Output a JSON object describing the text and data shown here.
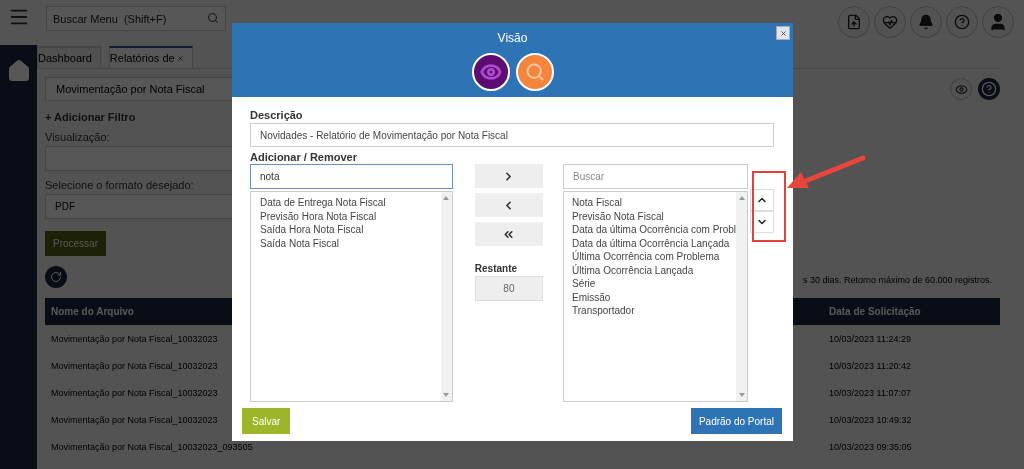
{
  "topbar": {
    "search": {
      "placeholder": "Buscar Menu  (Shift+F)"
    }
  },
  "tabs": [
    {
      "label": "Dashboard",
      "selected": false,
      "closable": false
    },
    {
      "label": "Relatórios de",
      "selected": true,
      "closable": true
    }
  ],
  "report_select": {
    "value": "Movimentação por Nota Fiscal"
  },
  "add_filter": "+ Adicionar Filtro",
  "visualization": {
    "label": "Visualização:"
  },
  "format": {
    "label": "Selecione o formato desejado:",
    "value": "PDF"
  },
  "process_button": "Processar",
  "notice": "s 30 dias. Retorno máximo de 60.000 registros.",
  "table": {
    "columns": [
      "Nome do Arquivo",
      "Data de Solicitação"
    ],
    "rows": [
      [
        "Movimentação por Nota Fiscal_10032023",
        "10/03/2023 11:24:29"
      ],
      [
        "Movimentação por Nota Fiscal_10032023",
        "10/03/2023 11:20:42"
      ],
      [
        "Movimentação por Nota Fiscal_10032023",
        "10/03/2023 11:07:07"
      ],
      [
        "Movimentação por Nota Fiscal_10032023",
        "10/03/2023 10:49:32"
      ],
      [
        "Movimentação por Nota Fiscal_10032023_093505",
        "10/03/2023 09:35:05"
      ]
    ]
  },
  "modal": {
    "title": "Visão",
    "description": {
      "label": "Descrição",
      "value": "Novidades - Relatório de Movimentação por Nota Fiscal"
    },
    "add_remove": {
      "label": "Adicionar / Remover",
      "search_value": "nota",
      "available": [
        "Data de Entrega Nota Fiscal",
        "Previsão Hora Nota Fiscal",
        "Saída Hora Nota Fiscal",
        "Saída Nota Fiscal"
      ],
      "remaining": {
        "label": "Restante",
        "value": "80"
      },
      "selected_search": {
        "placeholder": "Buscar"
      },
      "chosen": [
        "Nota Fiscal",
        "Previsão Nota Fiscal",
        "Data da última Ocorrência com Probl",
        "Data da última Ocorrência Lançada",
        "Última Ocorrência com Problema",
        "Última Ocorrência Lançada",
        "Série",
        "Emissão",
        "Transportador"
      ]
    },
    "save_button": "Salvar",
    "default_button": "Padrão do Portal"
  }
}
